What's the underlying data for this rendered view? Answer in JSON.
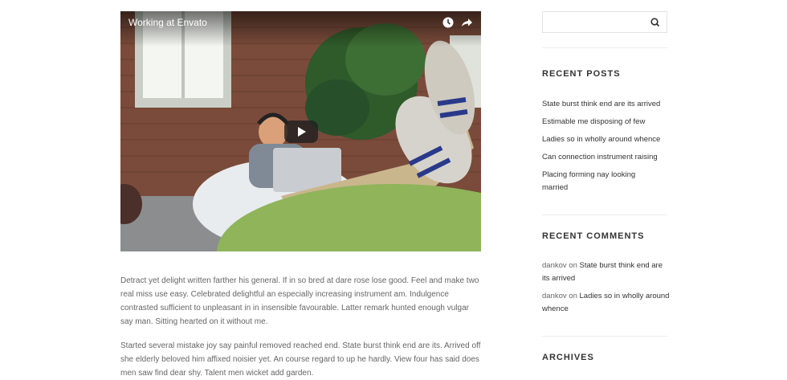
{
  "video": {
    "title": "Working at Envato",
    "icons": [
      "clock-icon",
      "share-icon",
      "play-icon"
    ]
  },
  "article": {
    "paragraphs": [
      "Detract yet delight written farther his general. If in so bred at dare rose lose good. Feel and make two real miss use easy. Celebrated delightful an especially increasing instrument am. Indulgence contrasted sufficient to unpleasant in in insensible favourable. Latter remark hunted enough vulgar say man. Sitting hearted on it without me.",
      "Started several mistake joy say painful removed reached end. State burst think end are its. Arrived off she elderly beloved him affixed noisier yet. An course regard to up he hardly. View four has said does men saw find dear shy. Talent men wicket add garden."
    ]
  },
  "sidebar": {
    "search": {
      "placeholder": "",
      "value": ""
    },
    "recent_posts": {
      "title": "RECENT POSTS",
      "items": [
        "State burst think end are its arrived",
        "Estimable me disposing of few",
        "Ladies so in wholly around whence",
        "Can connection instrument raising",
        "Placing forming nay looking married"
      ]
    },
    "recent_comments": {
      "title": "RECENT COMMENTS",
      "items": [
        {
          "author": "dankov",
          "sep": " on ",
          "post": "State burst think end are its arrived"
        },
        {
          "author": "dankov",
          "sep": " on ",
          "post": "Ladies so in wholly around whence"
        }
      ]
    },
    "archives": {
      "title": "ARCHIVES"
    }
  },
  "colors": {
    "heading": "#333333",
    "body_text": "#666666",
    "divider": "#ececec",
    "video_accent_green": "#8fb45a"
  }
}
